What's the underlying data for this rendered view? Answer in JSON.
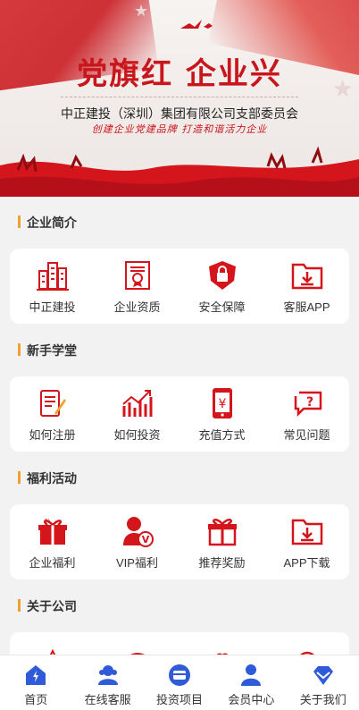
{
  "banner": {
    "title": "党旗红  企业兴",
    "subtitle": "中正建投（深圳）集团有限公司支部委员会",
    "slogan": "创建企业党建品牌   打造和谐活力企业"
  },
  "colors": {
    "brand_red": "#d4161c",
    "accent_orange": "#f0a030",
    "nav_blue": "#2f5bd8"
  },
  "sections": [
    {
      "title": "企业简介",
      "items": [
        {
          "label": "中正建投",
          "icon": "building-icon"
        },
        {
          "label": "企业资质",
          "icon": "certificate-icon"
        },
        {
          "label": "安全保障",
          "icon": "shield-lock-icon"
        },
        {
          "label": "客服APP",
          "icon": "download-folder-icon"
        }
      ]
    },
    {
      "title": "新手学堂",
      "items": [
        {
          "label": "如何注册",
          "icon": "register-notepad-icon"
        },
        {
          "label": "如何投资",
          "icon": "bar-chart-up-icon"
        },
        {
          "label": "充值方式",
          "icon": "phone-yen-icon"
        },
        {
          "label": "常见问题",
          "icon": "question-bubble-icon"
        }
      ]
    },
    {
      "title": "福利活动",
      "items": [
        {
          "label": "企业福利",
          "icon": "gift-box-icon"
        },
        {
          "label": "VIP福利",
          "icon": "vip-user-icon"
        },
        {
          "label": "推荐奖励",
          "icon": "present-bow-icon"
        },
        {
          "label": "APP下载",
          "icon": "download-folder-icon"
        }
      ]
    },
    {
      "title": "关于公司"
    }
  ],
  "tabbar": [
    {
      "label": "首页",
      "icon": "home-icon"
    },
    {
      "label": "在线客服",
      "icon": "service-icon"
    },
    {
      "label": "投资项目",
      "icon": "wallet-icon"
    },
    {
      "label": "会员中心",
      "icon": "user-icon"
    },
    {
      "label": "关于我们",
      "icon": "diamond-icon"
    }
  ]
}
